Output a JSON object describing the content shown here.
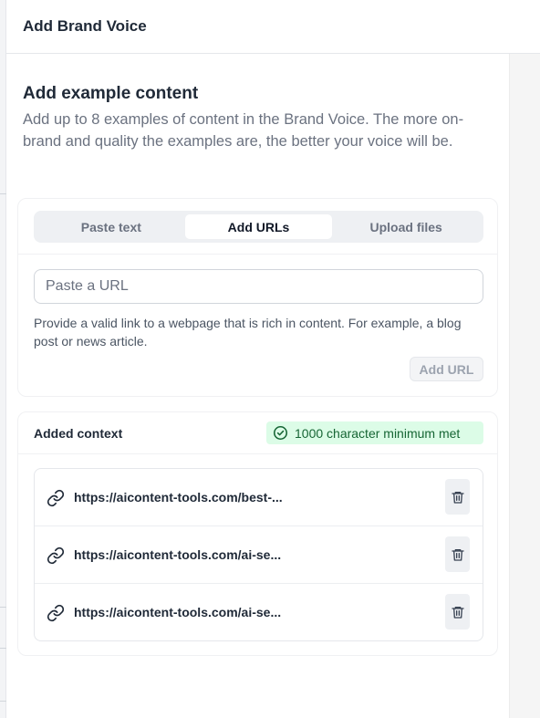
{
  "header": {
    "title": "Add Brand Voice"
  },
  "section": {
    "title": "Add example content",
    "description": "Add up to 8 examples of content in the Brand Voice. The more on-brand and quality the examples are, the better your voice will be."
  },
  "tabs": [
    {
      "label": "Paste text",
      "active": false
    },
    {
      "label": "Add URLs",
      "active": true
    },
    {
      "label": "Upload files",
      "active": false
    }
  ],
  "url_input": {
    "placeholder": "Paste a URL",
    "value": ""
  },
  "hint": "Provide a valid link to a webpage that is rich in content. For example, a blog post or news article.",
  "add_url_label": "Add URL",
  "context": {
    "title": "Added context",
    "status": "1000 character minimum met",
    "items": [
      {
        "url": "https://aicontent-tools.com/best-..."
      },
      {
        "url": "https://aicontent-tools.com/ai-se..."
      },
      {
        "url": "https://aicontent-tools.com/ai-se..."
      }
    ]
  },
  "icons": {
    "status": "check-circle-icon",
    "item": "link-icon",
    "delete": "trash-icon"
  },
  "colors": {
    "success_bg": "#dcfce7",
    "success_text": "#166534",
    "tab_track": "#eef0f3",
    "heading": "#1f2937",
    "muted": "#6b7280"
  }
}
